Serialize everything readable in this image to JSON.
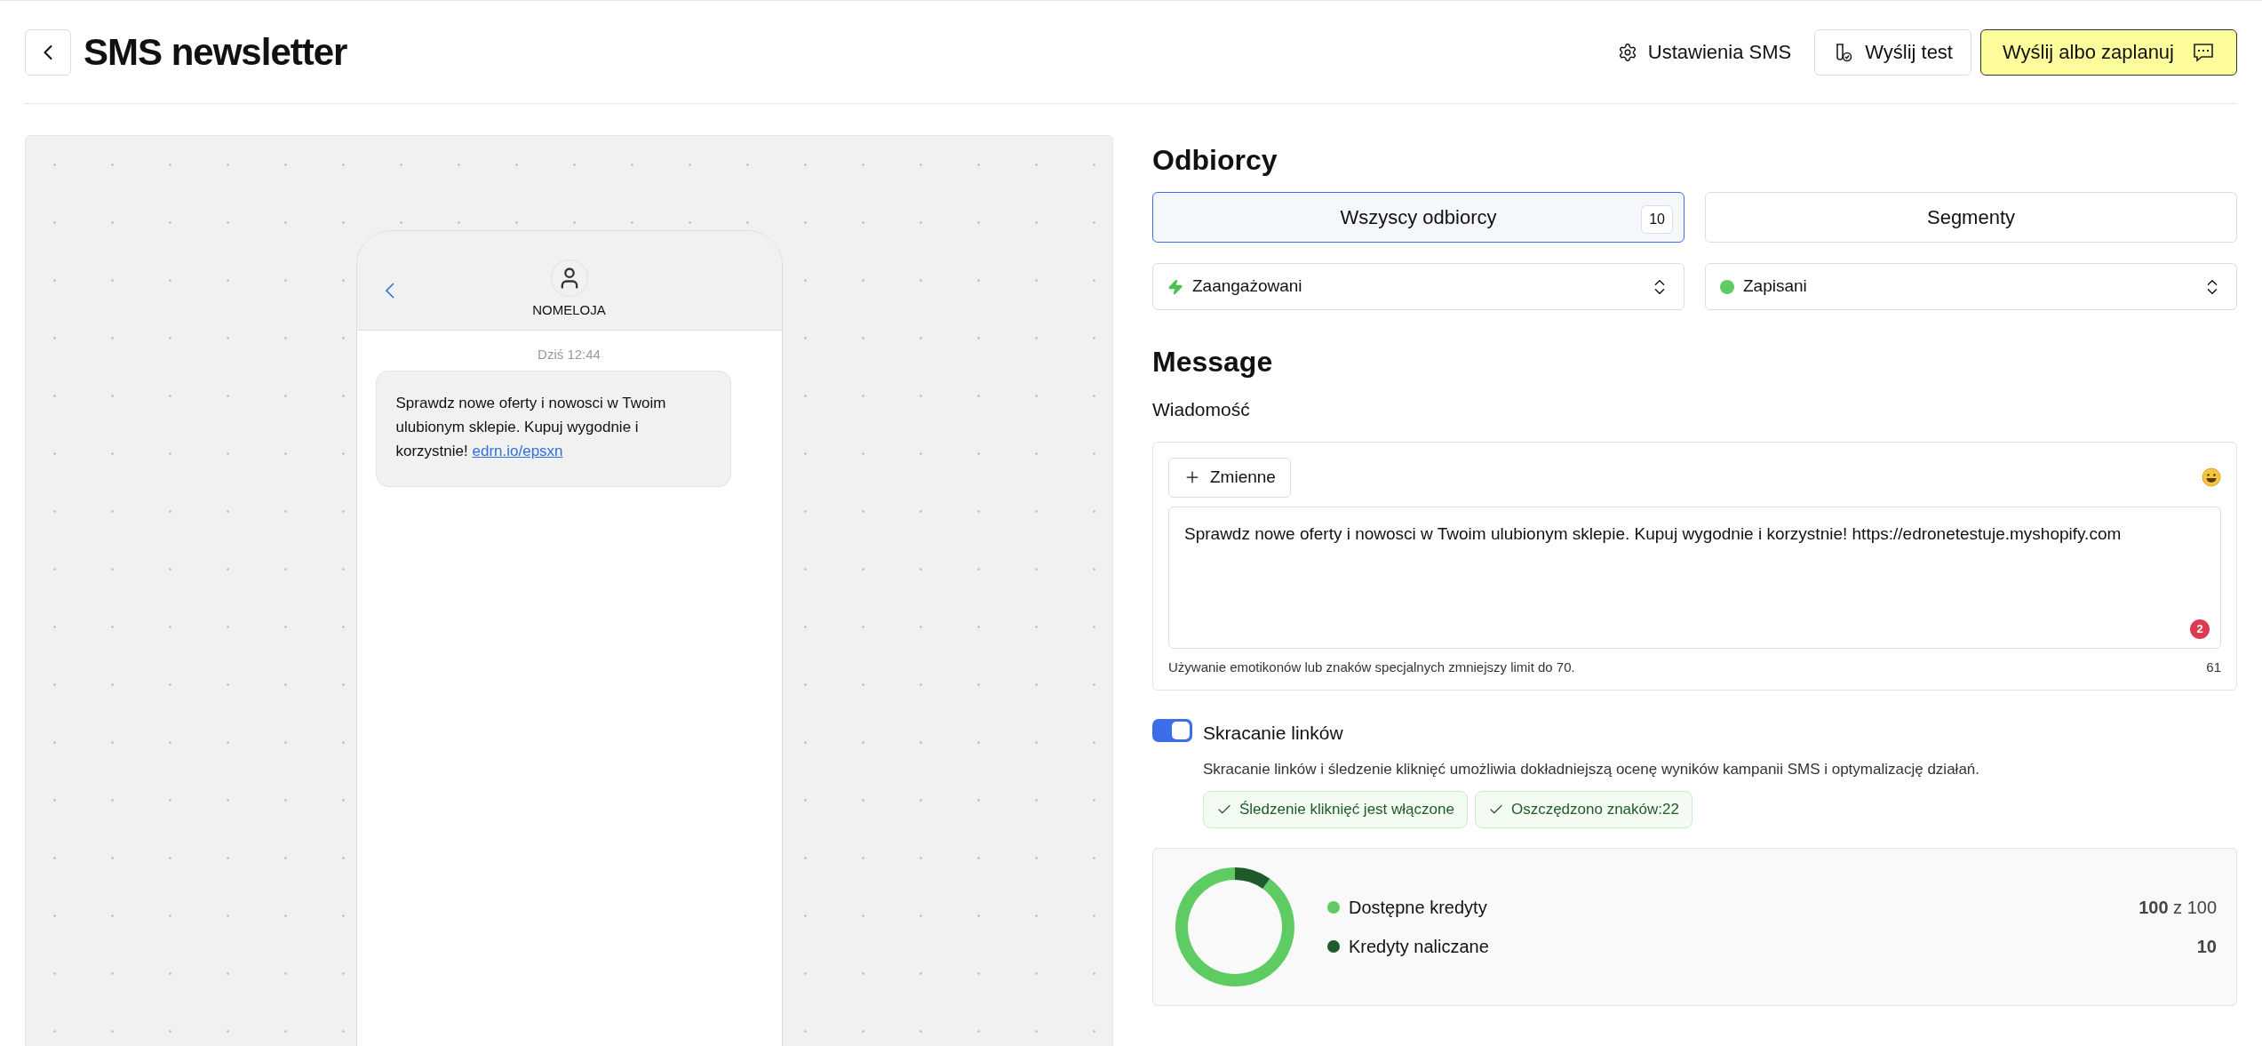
{
  "header": {
    "title": "SMS newsletter",
    "actions": [
      {
        "kind": "settings",
        "label": "Ustawienia SMS"
      },
      {
        "kind": "test",
        "label": "Wyślij test"
      },
      {
        "kind": "send",
        "label": "Wyślij albo zaplanuj"
      }
    ]
  },
  "preview": {
    "sender": "NOMELOJA",
    "time": "Dziś 12:44",
    "message": "Sprawdz nowe oferty i nowosci w Twoim ulubionym sklepie. Kupuj wygodnie i korzystnie!",
    "link": "edrn.io/epsxn"
  },
  "recipients": {
    "heading": "Odbiorcy",
    "tabs": [
      {
        "label": "Wszyscy odbiorcy",
        "count": "10",
        "selected": true
      },
      {
        "label": "Segmenty",
        "selected": false
      }
    ],
    "selects": [
      {
        "kind": "bolt",
        "value": "Zaangażowani"
      },
      {
        "kind": "dot",
        "value": "Zapisani"
      }
    ]
  },
  "message": {
    "heading": "Message",
    "label": "Wiadomość",
    "variables_button": "Zmienne",
    "text": "Sprawdz nowe oferty i nowosci w Twoim ulubionym sklepie. Kupuj wygodnie i korzystnie! https://edronetestuje.myshopify.com",
    "error_count": "2",
    "hint": "Używanie emotikonów lub znaków specjalnych zmniejszy limit do 70.",
    "char_count": "61"
  },
  "link_shortening": {
    "on": true,
    "label": "Skracanie linków",
    "description": "Skracanie linków i śledzenie kliknięć umożliwia dokładniejszą ocenę wyników kampanii SMS i optymalizację działań.",
    "chips": [
      "Śledzenie kliknięć jest włączone",
      "Oszczędzono znaków:22"
    ]
  },
  "credits": {
    "chart_data": {
      "type": "donut",
      "values": [
        90,
        10
      ]
    },
    "legend": [
      {
        "label": "Dostępne kredyty",
        "color": "#5ecb63",
        "value": "**100** z 100"
      },
      {
        "label": "Kredyty naliczane",
        "color": "#1f5a2a",
        "value": "**10**"
      }
    ]
  }
}
